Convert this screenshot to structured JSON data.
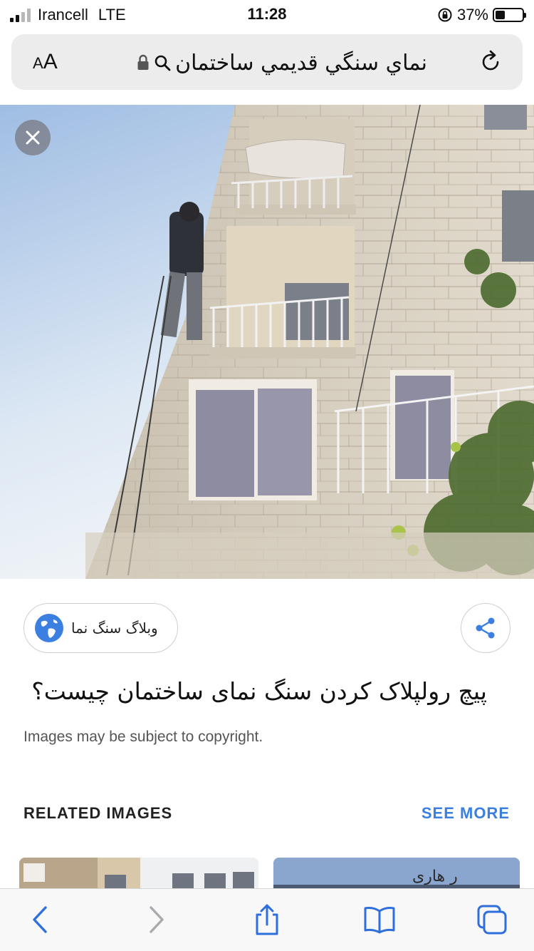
{
  "status_bar": {
    "carrier": "Irancell",
    "network": "LTE",
    "time": "11:28",
    "battery": "37%",
    "battery_level": 0.37
  },
  "address_bar": {
    "aa_label": "AA",
    "url": "نماي سنگي قديمي ساختمان",
    "icons": [
      "lock-icon",
      "search-icon",
      "reload-icon"
    ]
  },
  "hero": {
    "close_icon": "close-icon"
  },
  "source": {
    "name": "وبلاگ سنگ نما",
    "icon": "globe-icon"
  },
  "result": {
    "title": "پیچ رولپلاک کردن سنگ نمای ساختمان چیست؟",
    "copyright": "Images may be subject to copyright."
  },
  "related": {
    "heading": "RELATED IMAGES",
    "see_more": "SEE MORE",
    "thumb_2_text": "ر هاری"
  },
  "toolbar": {
    "icons": [
      "back-icon",
      "forward-icon",
      "share-icon",
      "bookmarks-icon",
      "tabs-icon"
    ]
  },
  "colors": {
    "accent": "#3b7fe0",
    "globe": "#3b7fe0"
  }
}
